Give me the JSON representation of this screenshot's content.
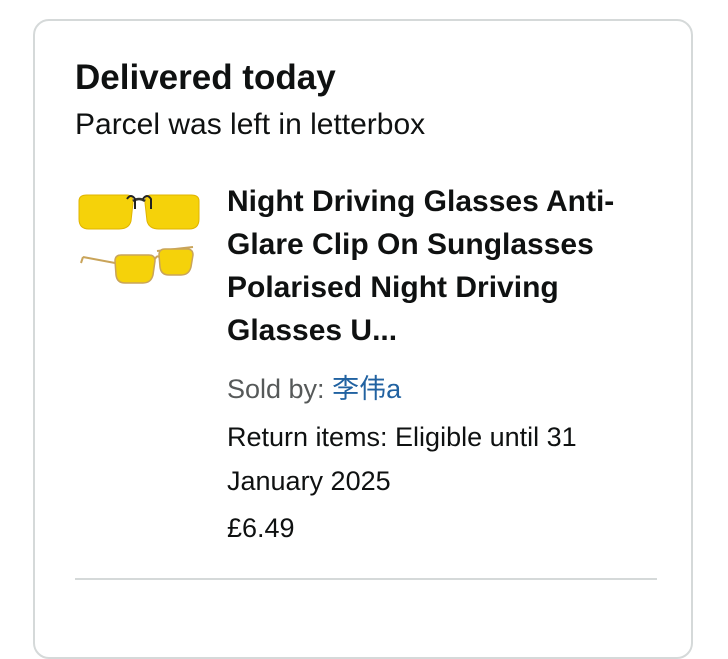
{
  "delivery": {
    "status": "Delivered today",
    "detail": "Parcel was left in letterbox"
  },
  "product": {
    "image_icon": "yellow-night-driving-glasses-image",
    "title": "Night Driving Glasses Anti-Glare Clip On Sunglasses Polarised Night Driving Glasses U...",
    "sold_by_label": "Sold by:",
    "seller": "李伟a",
    "return_line_1": "Return items: Eligible until 31",
    "return_line_2": "January 2025",
    "price": "£6.49"
  },
  "colors": {
    "lens_yellow": "#f5d20a",
    "link_blue": "#2162a1",
    "secondary_text": "#565959",
    "border": "#d5d9d9"
  }
}
